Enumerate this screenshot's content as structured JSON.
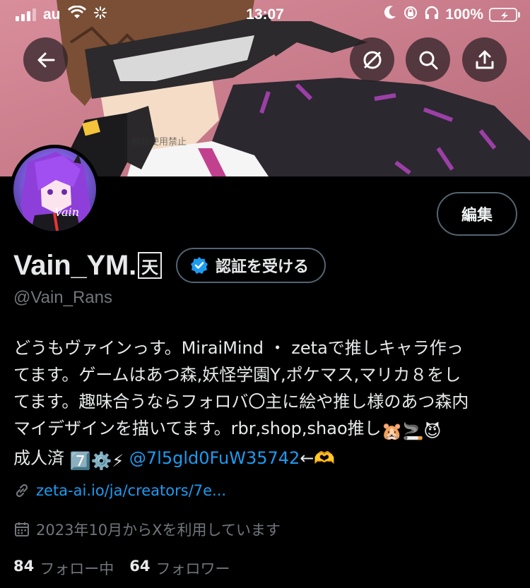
{
  "status_bar": {
    "carrier": "au",
    "time": "13:07",
    "battery_text": "100%",
    "battery_level": 1.0,
    "battery_color": "#34c759"
  },
  "nav": {
    "back_icon": "arrow-left-icon",
    "mute_icon": "mute-circle-icon",
    "search_icon": "search-icon",
    "share_icon": "share-upload-icon"
  },
  "banner": {
    "watermark": "無断使用禁止"
  },
  "avatar": {
    "signature": "Vain"
  },
  "profile": {
    "edit_label": "編集",
    "display_name": "Vain_YM.",
    "name_kanji": "天",
    "verify_label": "認証を受ける",
    "handle": "@Vain_Rans"
  },
  "bio": {
    "line1": "どうもヴァインっす。MiraiMind ・ zetaで推しキャラ作っ",
    "line2": "てます。ゲームはあつ森,妖怪学園Y,ポケマス,マリカ８をし",
    "line3": "てます。趣味合うならフォロバ〇主に絵や推し様のあつ森内",
    "line4_text": "マイデザインを描いてます。rbr,shop,shao推し",
    "line4_emojis": "🐹🚬😈",
    "line5_text": "成人済 ",
    "line5_emojis": "7️⃣⚙️⚡",
    "mention": "@7l5gld0FuW35742",
    "line5_tail": "←🫶"
  },
  "meta": {
    "link_icon": "link-icon",
    "link_text": "zeta-ai.io/ja/creators/7e...",
    "calendar_icon": "calendar-icon",
    "joined_text": "2023年10月からXを利用しています"
  },
  "stats": {
    "following_count": "84",
    "following_label": "フォロー中",
    "followers_count": "64",
    "followers_label": "フォロワー"
  },
  "colors": {
    "accent": "#1d9bf0",
    "muted": "#71767b",
    "border": "#536471",
    "banner_pink": "#d98e9c"
  }
}
